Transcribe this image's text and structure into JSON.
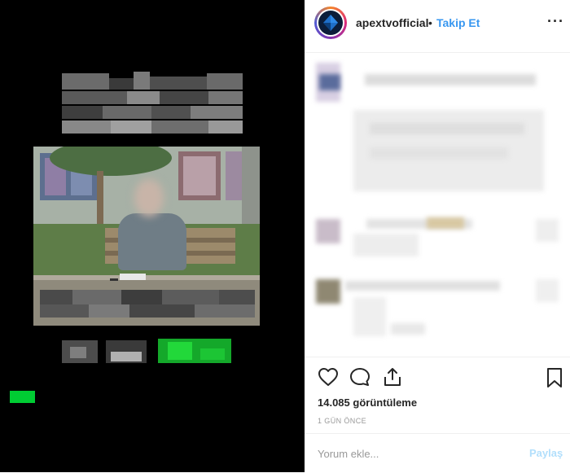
{
  "post_header": {
    "username": "apextvofficial",
    "separator": "•",
    "follow_label": "Takip Et",
    "more_label": "···"
  },
  "stats": {
    "views": "14.085 görüntüleme",
    "time": "1 GÜN ÖNCE"
  },
  "add_comment": {
    "placeholder": "Yorum ekle...",
    "post_label": "Paylaş"
  },
  "icons": {
    "like": "heart-icon",
    "comment": "comment-icon",
    "share": "share-icon",
    "save": "bookmark-icon",
    "more": "more-options-icon"
  },
  "colors": {
    "follow": "#3897f0",
    "post_disabled": "#b2dffc",
    "media_background": "#000000",
    "pixel_green": "#00cc33"
  }
}
